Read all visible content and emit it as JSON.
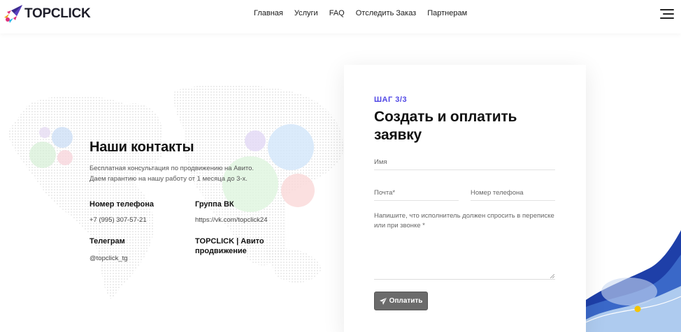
{
  "header": {
    "logo_text": "TOPCLICK",
    "nav": [
      "Главная",
      "Услуги",
      "FAQ",
      "Отследить Заказ",
      "Партнерам"
    ]
  },
  "contacts": {
    "title": "Наши контакты",
    "description_line1": "Бесплатная консультация по продвижению на Авито.",
    "description_line2": "Даем гарантию на нашу работу от 1 месяца до 3-х.",
    "phone_label": "Номер телефона",
    "phone_value": "+7 (995) 307-57-21",
    "vk_label": "Группа ВК",
    "vk_value": "https://vk.com/topclick24",
    "telegram_label": "Телеграм",
    "telegram_value": "@topclick_tg",
    "brand_label": "TOPCLICK | Авито продвижение"
  },
  "form": {
    "step": "ШАГ 3/3",
    "title": "Создать и оплатить заявку",
    "name_placeholder": "Имя",
    "email_placeholder": "Почта*",
    "phone_placeholder": "Номер телефона",
    "message_placeholder": "Напишите, что исполнитель должен спросить в переписке или при звонке *",
    "pay_button": "Оплатить"
  },
  "colors": {
    "accent": "#4f46e5",
    "button": "#6b6b6b",
    "wave_dark": "#1e3fa8",
    "dot": "#f5c400"
  }
}
